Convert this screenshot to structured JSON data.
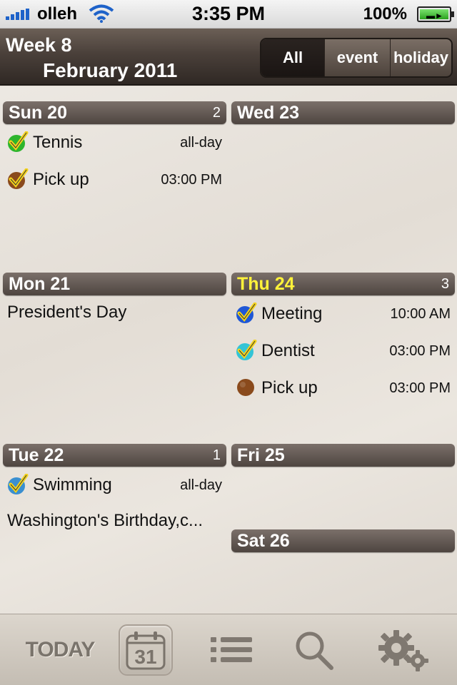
{
  "status_bar": {
    "carrier": "olleh",
    "time": "3:35 PM",
    "battery": "100%"
  },
  "header": {
    "week": "Week 8",
    "month": "February 2011",
    "filters": [
      "All",
      "event",
      "holiday"
    ],
    "active_filter": "All"
  },
  "days": {
    "sun": {
      "label": "Sun 20",
      "count": "2",
      "events": [
        {
          "title": "Tennis",
          "time": "all-day",
          "color": "#2db52d",
          "icon": "check-icon"
        },
        {
          "title": "Pick up",
          "time": "03:00 PM",
          "color": "#8a4a1c",
          "icon": "check-icon"
        }
      ]
    },
    "wed": {
      "label": "Wed 23"
    },
    "mon": {
      "label": "Mon 21",
      "holiday": "President's Day"
    },
    "thu": {
      "label": "Thu 24",
      "count": "3",
      "events": [
        {
          "title": "Meeting",
          "time": "10:00 AM",
          "color": "#1f57d6",
          "icon": "check-icon"
        },
        {
          "title": "Dentist",
          "time": "03:00 PM",
          "color": "#33c4d6",
          "icon": "check-icon"
        },
        {
          "title": "Pick up",
          "time": "03:00 PM",
          "color": "#8a4a1c",
          "icon": "dot-icon"
        }
      ]
    },
    "tue": {
      "label": "Tue 22",
      "count": "1",
      "events": [
        {
          "title": "Swimming",
          "time": "all-day",
          "color": "#3a8fd0",
          "icon": "check-icon"
        }
      ],
      "holiday": "Washington's Birthday,c..."
    },
    "fri": {
      "label": "Fri 25"
    },
    "sat": {
      "label": "Sat 26"
    }
  },
  "tabbar": {
    "today_label": "TODAY",
    "calendar_day": "31"
  },
  "colors": {
    "today_header_text": "#fff23a",
    "header_brown": "#4a403a",
    "check_yellow": "#f3d21c"
  }
}
